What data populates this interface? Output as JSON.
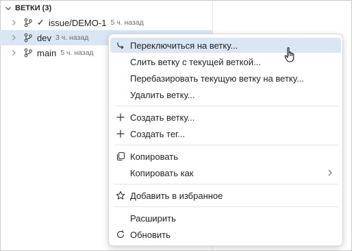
{
  "branches_section": {
    "header": "ВЕТКИ (3)",
    "items": [
      {
        "name": "issue/DEMO-1",
        "time": "5 ч. назад",
        "current_mark": "✓"
      },
      {
        "name": "dev",
        "time": "3 ч. назад"
      },
      {
        "name": "main",
        "time": "5 ч. назад"
      }
    ]
  },
  "context_menu": {
    "items": [
      {
        "label": "Переключиться на ветку...",
        "icon": "checkout-icon"
      },
      {
        "label": "Слить ветку с текущей веткой..."
      },
      {
        "label": "Перебазировать текущую ветку на ветку..."
      },
      {
        "label": "Удалить ветку..."
      },
      {
        "label": "Создать ветку...",
        "icon": "plus-icon"
      },
      {
        "label": "Создать тег...",
        "icon": "plus-icon"
      },
      {
        "label": "Копировать",
        "icon": "copy-icon"
      },
      {
        "label": "Копировать как",
        "icon": "chevron-right-icon"
      },
      {
        "label": "Добавить в избранное",
        "icon": "star-icon"
      },
      {
        "label": "Расширить"
      },
      {
        "label": "Обновить",
        "icon": "refresh-icon"
      }
    ]
  },
  "colors": {
    "selection": "#dbe6f5",
    "menu_hover": "#dbe6f5"
  }
}
